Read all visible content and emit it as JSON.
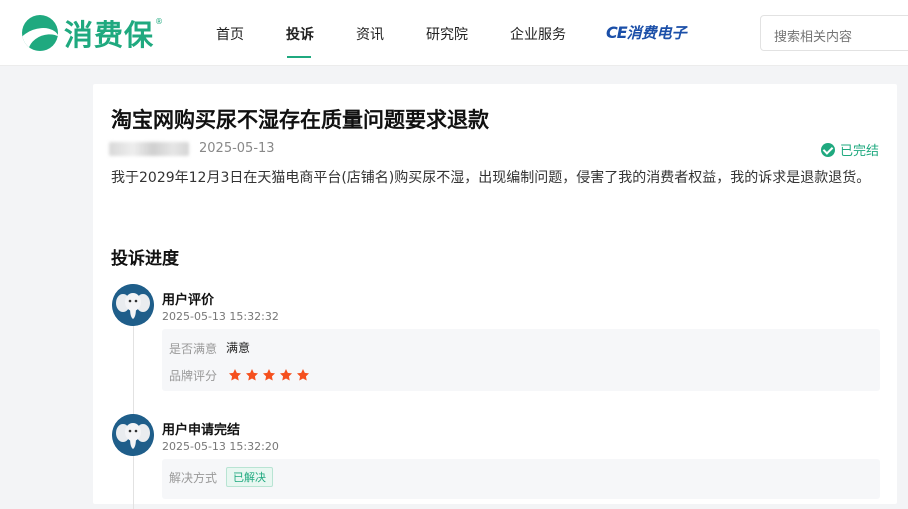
{
  "brand": {
    "name": "消费保",
    "reg_mark": "®"
  },
  "nav": {
    "items": [
      {
        "label": "首页"
      },
      {
        "label": "投诉"
      },
      {
        "label": "资讯"
      },
      {
        "label": "研究院"
      },
      {
        "label": "企业服务"
      }
    ],
    "active": "投诉",
    "ce_brand": {
      "prefix": "CE",
      "label": "消费电子"
    }
  },
  "search": {
    "placeholder": "搜索相关内容"
  },
  "complaint": {
    "title": "淘宝网购买尿不湿存在质量问题要求退款",
    "date": "2025-05-13",
    "status": "已完结",
    "description": "我于2029年12月3日在天猫电商平台(店铺名)购买尿不湿，出现编制问题，侵害了我的消费者权益，我的诉求是退款退货。"
  },
  "progress": {
    "title": "投诉进度",
    "events": [
      {
        "title": "用户评价",
        "time": "2025-05-13 15:32:32",
        "rows": [
          {
            "label": "是否满意",
            "value": "满意"
          },
          {
            "label": "品牌评分",
            "stars": 5
          }
        ]
      },
      {
        "title": "用户申请完结",
        "time": "2025-05-13 15:32:20",
        "rows": [
          {
            "label": "解决方式",
            "badge": "已解决"
          }
        ]
      }
    ]
  },
  "colors": {
    "brand_green": "#1fa97f",
    "star_orange": "#f5501e",
    "ce_blue": "#1b4fa8",
    "avatar_blue": "#1f5e8a"
  }
}
